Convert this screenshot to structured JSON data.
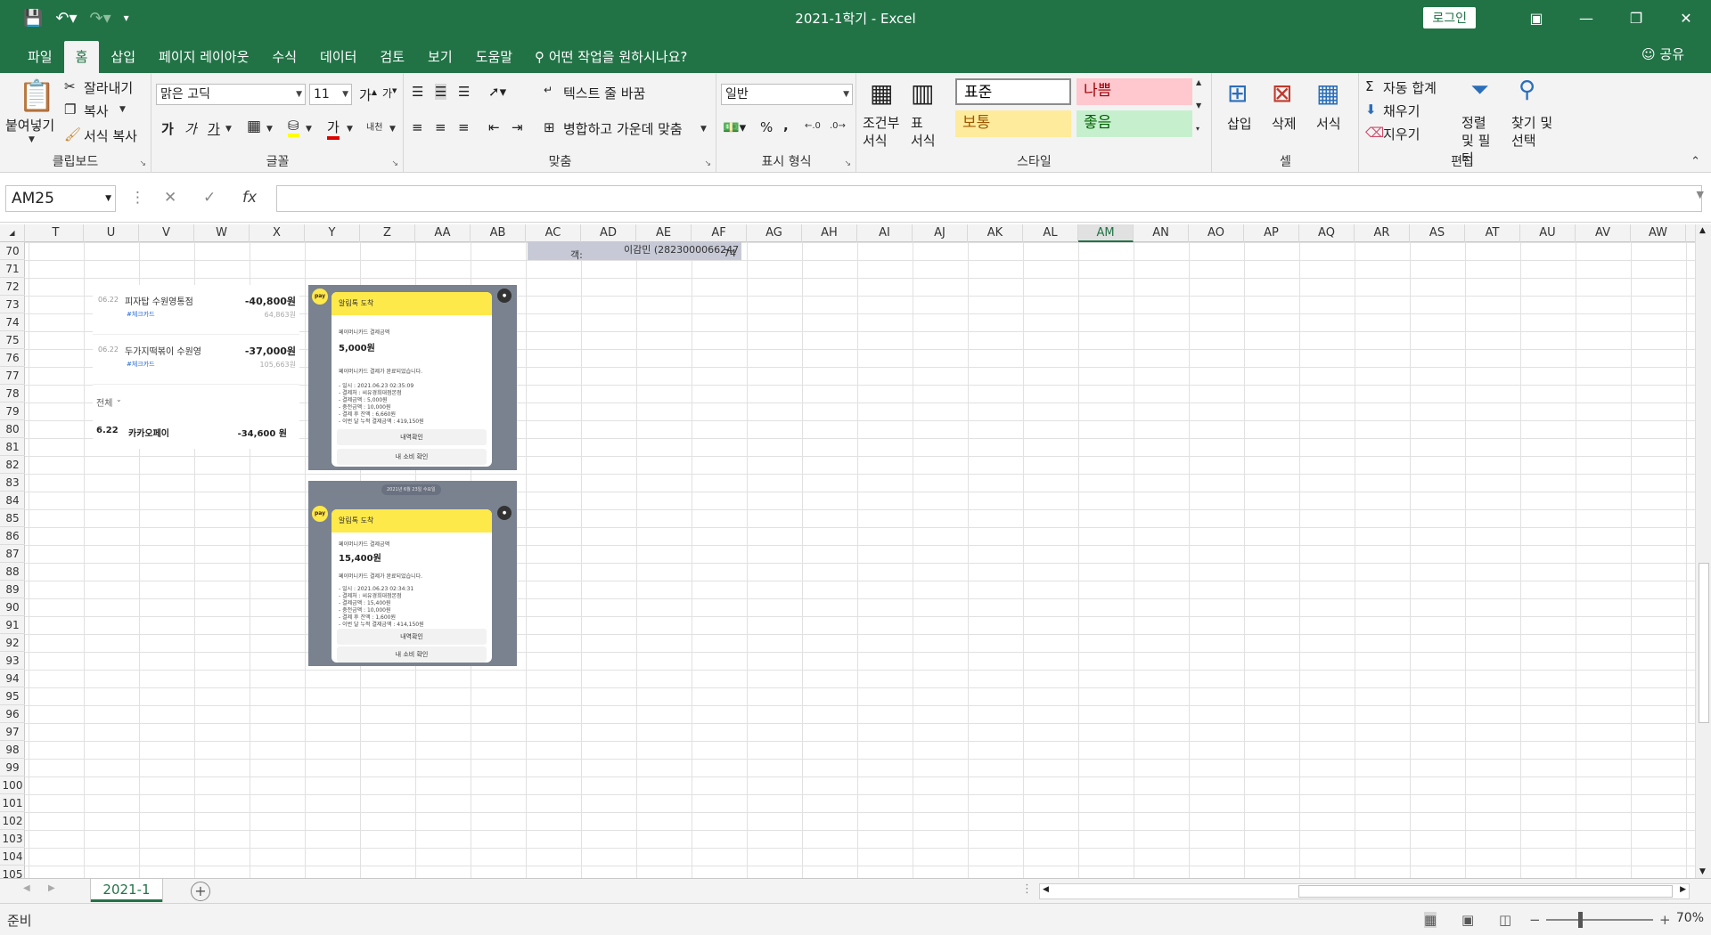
{
  "window": {
    "title": "2021-1학기  -  Excel",
    "login_label": "로그인",
    "share_label": "공유"
  },
  "tabs": [
    "파일",
    "홈",
    "삽입",
    "페이지 레이아웃",
    "수식",
    "데이터",
    "검토",
    "보기",
    "도움말"
  ],
  "active_tab": "홈",
  "tell_me": "어떤 작업을 원하시나요?",
  "ribbon": {
    "clipboard": {
      "label": "클립보드",
      "paste": "붙여넣기",
      "cut": "잘라내기",
      "copy": "복사",
      "format_painter": "서식 복사"
    },
    "font": {
      "label": "글꼴",
      "font_name": "맑은 고딕",
      "font_size": "11",
      "bold": "가",
      "italic": "가",
      "underline": "가",
      "font_color_glyph": "가",
      "phonetic": "내천"
    },
    "alignment": {
      "label": "맞춤",
      "wrap_text": "텍스트 줄 바꿈",
      "merge_center": "병합하고 가운데 맞춤"
    },
    "number": {
      "label": "표시 형식",
      "format": "일반",
      "percent": "%",
      "comma": ","
    },
    "styles": {
      "label": "스타일",
      "conditional": "조건부 서식",
      "table": "표 서식",
      "cells": [
        {
          "name": "표준",
          "bg": "#ffffff",
          "fg": "#000000"
        },
        {
          "name": "나쁨",
          "bg": "#ffc7ce",
          "fg": "#9c0006"
        },
        {
          "name": "보통",
          "bg": "#ffeb9c",
          "fg": "#9c5700"
        },
        {
          "name": "좋음",
          "bg": "#c6efce",
          "fg": "#006100"
        }
      ]
    },
    "cells_group": {
      "label": "셀",
      "insert": "삽입",
      "delete": "삭제",
      "format": "서식"
    },
    "editing": {
      "label": "편집",
      "autosum": "자동 합계",
      "fill": "채우기",
      "clear": "지우기",
      "sort_filter": "정렬 및 필터",
      "find_select": "찾기 및 선택"
    }
  },
  "formula_bar": {
    "name_box": "AM25",
    "fx": "fx",
    "value": ""
  },
  "grid": {
    "columns": [
      "T",
      "U",
      "V",
      "W",
      "X",
      "Y",
      "Z",
      "AA",
      "AB",
      "AC",
      "AD",
      "AE",
      "AF",
      "AG",
      "AH",
      "AI",
      "AJ",
      "AK",
      "AL",
      "AM",
      "AN",
      "AO",
      "AP",
      "AQ",
      "AR",
      "AS",
      "AT",
      "AU",
      "AV",
      "AW"
    ],
    "selected_column": "AM",
    "rows": [
      "70",
      "71",
      "72",
      "73",
      "74",
      "75",
      "76",
      "77",
      "78",
      "79",
      "80",
      "81",
      "82",
      "83",
      "84",
      "85",
      "86",
      "87",
      "88",
      "89",
      "90",
      "91",
      "92",
      "93",
      "94",
      "95",
      "96",
      "97",
      "98",
      "99",
      "100",
      "101",
      "102",
      "103",
      "104",
      "105"
    ]
  },
  "statement": {
    "items": [
      {
        "date": "06.22",
        "merchant": "피자탑 수원영통점",
        "tag": "#체크카드",
        "amount": "-40,800원",
        "balance": "64,863원"
      },
      {
        "date": "06.22",
        "merchant": "두가지떡볶이 수원영",
        "tag": "#체크카드",
        "amount": "-37,000원",
        "balance": "105,663원"
      }
    ],
    "filter": "전체",
    "summary": {
      "date": "6.22",
      "merchant": "카카오페이",
      "amount": "-34,600 원"
    }
  },
  "receipt_fragment": {
    "text1": "객:",
    "text2": "이감민 (2823000066247",
    "text3": "74"
  },
  "kakao": [
    {
      "badge": "pay",
      "header": "알림톡 도착",
      "label": "페이머니카드 결제금액",
      "amount": "5,000원",
      "message": "페이머니카드 결제가 완료되었습니다.",
      "lines": [
        "- 일시 : 2021.06.23 02:35:09",
        "- 결제처 : 씨유경희대점본점",
        "- 결제금액 : 5,000원",
        "- 충전금액 : 10,000원",
        "- 결제 후 잔액 : 6,660원",
        "- 이번 달 누적 결제금액 : 419,150원"
      ],
      "btn1": "내역확인",
      "btn2": "내 소비 확인"
    },
    {
      "date_chip": "2021년 6월 23일 수요일",
      "badge": "pay",
      "header": "알림톡 도착",
      "label": "페이머니카드 결제금액",
      "amount": "15,400원",
      "message": "페이머니카드 결제가 완료되었습니다.",
      "lines": [
        "- 일시 : 2021.06.23 02:34:31",
        "- 결제처 : 씨유경희대점본점",
        "- 결제금액 : 15,400원",
        "- 충전금액 : 10,000원",
        "- 결제 후 잔액 : 1,600원",
        "- 이번 달 누적 결제금액 : 414,150원"
      ],
      "btn1": "내역확인",
      "btn2": "내 소비 확인"
    }
  ],
  "sheet": {
    "tab": "2021-1",
    "add": "+"
  },
  "status": {
    "ready": "준비",
    "zoom": "70%"
  }
}
